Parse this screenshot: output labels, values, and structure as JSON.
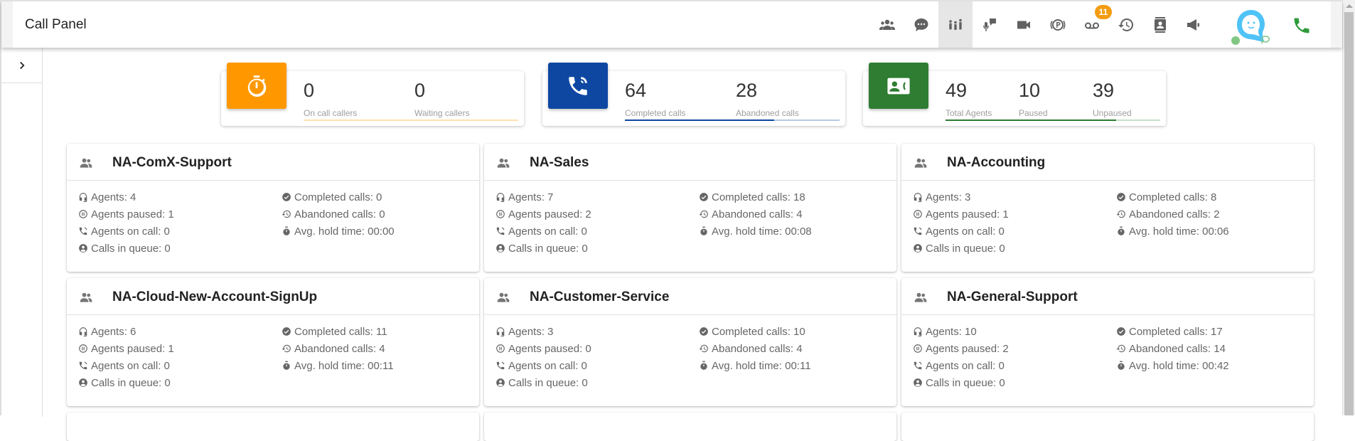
{
  "header": {
    "title": "Call Panel",
    "toolbar": [
      {
        "icon": "groups-icon",
        "label": "Contacts"
      },
      {
        "icon": "chat-icon",
        "label": "Chat"
      },
      {
        "icon": "call-panel-icon",
        "label": "Call Panel",
        "active": true
      },
      {
        "icon": "voice-mic-icon",
        "label": "Voice"
      },
      {
        "icon": "video-icon",
        "label": "Video"
      },
      {
        "icon": "parking-icon",
        "label": "Parking"
      },
      {
        "icon": "voicemail-icon",
        "label": "Voicemail",
        "badge": "11"
      },
      {
        "icon": "history-icon",
        "label": "History"
      },
      {
        "icon": "contact-book-icon",
        "label": "Address book"
      },
      {
        "icon": "megaphone-icon",
        "label": "Announcements"
      }
    ],
    "avatar_icon": "assistant-avatar-icon",
    "phone_icon": "phone-icon"
  },
  "colors": {
    "orange": "#ff9800",
    "blue": "#0d47a1",
    "green": "#2e7d32",
    "badge": "#f39c12"
  },
  "summary": {
    "callers": {
      "icon": "timer-icon",
      "on_call": {
        "value": "0",
        "label": "On call callers"
      },
      "waiting": {
        "value": "0",
        "label": "Waiting callers"
      },
      "progress": 0
    },
    "calls": {
      "icon": "phone-in-talk-icon",
      "completed": {
        "value": "64",
        "label": "Completed calls"
      },
      "abandoned": {
        "value": "28",
        "label": "Abandoned calls"
      },
      "progress": 0.696
    },
    "agents": {
      "icon": "contact-phone-icon",
      "total": {
        "value": "49",
        "label": "Total Agents"
      },
      "paused": {
        "value": "10",
        "label": "Paused"
      },
      "unpaused": {
        "value": "39",
        "label": "Unpaused"
      },
      "progress": 0.796
    }
  },
  "queues": [
    {
      "name": "NA-ComX-Support",
      "agents": "Agents: 4",
      "paused": "Agents paused: 1",
      "on_call": "Agents on call: 0",
      "in_queue": "Calls in queue: 0",
      "completed": "Completed calls: 0",
      "abandoned": "Abandoned calls: 0",
      "hold": "Avg. hold time: 00:00"
    },
    {
      "name": "NA-Sales",
      "agents": "Agents: 7",
      "paused": "Agents paused: 2",
      "on_call": "Agents on call: 0",
      "in_queue": "Calls in queue: 0",
      "completed": "Completed calls: 18",
      "abandoned": "Abandoned calls: 4",
      "hold": "Avg. hold time: 00:08"
    },
    {
      "name": "NA-Accounting",
      "agents": "Agents: 3",
      "paused": "Agents paused: 1",
      "on_call": "Agents on call: 0",
      "in_queue": "Calls in queue: 0",
      "completed": "Completed calls: 8",
      "abandoned": "Abandoned calls: 2",
      "hold": "Avg. hold time: 00:06"
    },
    {
      "name": "NA-Cloud-New-Account-SignUp",
      "agents": "Agents: 6",
      "paused": "Agents paused: 1",
      "on_call": "Agents on call: 0",
      "in_queue": "Calls in queue: 0",
      "completed": "Completed calls: 11",
      "abandoned": "Abandoned calls: 4",
      "hold": "Avg. hold time: 00:11"
    },
    {
      "name": "NA-Customer-Service",
      "agents": "Agents: 3",
      "paused": "Agents paused: 0",
      "on_call": "Agents on call: 0",
      "in_queue": "Calls in queue: 0",
      "completed": "Completed calls: 10",
      "abandoned": "Abandoned calls: 4",
      "hold": "Avg. hold time: 00:11"
    },
    {
      "name": "NA-General-Support",
      "agents": "Agents: 10",
      "paused": "Agents paused: 2",
      "on_call": "Agents on call: 0",
      "in_queue": "Calls in queue: 0",
      "completed": "Completed calls: 17",
      "abandoned": "Abandoned calls: 14",
      "hold": "Avg. hold time: 00:42"
    }
  ]
}
